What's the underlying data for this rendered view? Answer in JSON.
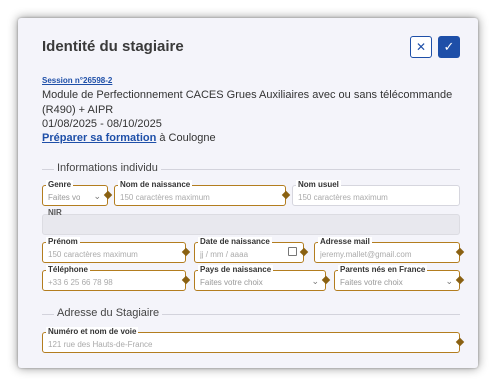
{
  "modal": {
    "title": "Identité du stagiaire",
    "cancel_glyph": "✕",
    "confirm_glyph": "✓"
  },
  "session": {
    "link": "Session n°26598-2",
    "description": "Module de Perfectionnement CACES Grues Auxiliaires avec ou sans télécommande (R490) + AIPR",
    "dates": "01/08/2025 - 08/10/2025",
    "prep_link": "Préparer sa formation",
    "location": " à Coulogne"
  },
  "sections": {
    "info": "Informations individu",
    "address": "Adresse du Stagiaire"
  },
  "fields": {
    "genre": {
      "label": "Genre",
      "value": "Faites vo"
    },
    "nom_naissance": {
      "label": "Nom de naissance",
      "placeholder": "150 caractères maximum"
    },
    "nom_usuel": {
      "label": "Nom usuel",
      "placeholder": "150 caractères maximum"
    },
    "nir": {
      "label": "NIR"
    },
    "prenom": {
      "label": "Prénom",
      "placeholder": "150 caractères maximum"
    },
    "date_naissance": {
      "label": "Date de naissance",
      "placeholder": "jj / mm / aaaa"
    },
    "email": {
      "label": "Adresse mail",
      "placeholder": "jeremy.mallet@gmail.com"
    },
    "telephone": {
      "label": "Téléphone",
      "placeholder": "+33 6 25 66 78 98"
    },
    "pays_naissance": {
      "label": "Pays de naissance",
      "value": "Faites votre choix"
    },
    "parents_france": {
      "label": "Parents nés en France",
      "value": "Faites votre choix"
    },
    "voie": {
      "label": "Numéro et nom de voie",
      "placeholder": "121 rue des Hauts-de-France"
    }
  },
  "colors": {
    "accent": "#1e4fa8",
    "required_border": "#b37d1f",
    "diamond": "#8a6112",
    "card_bg": "#f4f4fa"
  }
}
